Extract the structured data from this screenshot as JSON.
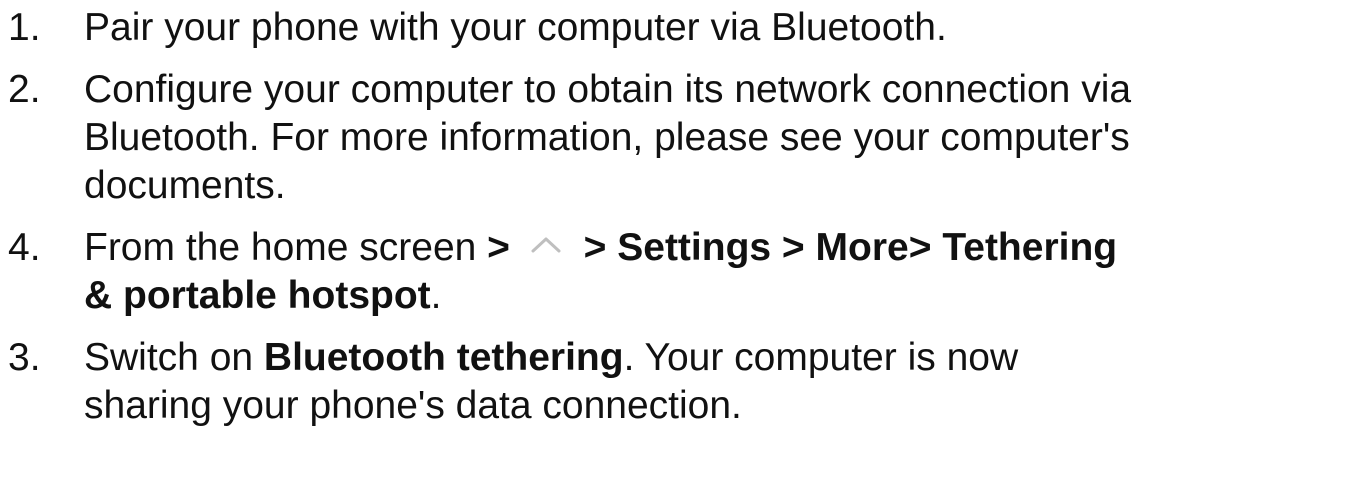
{
  "steps": [
    {
      "number": "1.",
      "text": "Pair your phone with your computer via Bluetooth."
    },
    {
      "number": "2.",
      "line1": "Configure your computer to obtain its network connection via",
      "line2": "Bluetooth. For more information, please see your computer's",
      "line3": "documents."
    },
    {
      "number": "4.",
      "prefix": "From the home screen",
      "sep1": " >",
      "icon": "chevron-up-icon",
      "path": " > Settings > More> Tethering",
      "path2": "& portable hotspot",
      "suffix": "."
    },
    {
      "number": "3.",
      "prefix": "Switch on ",
      "bold": "Bluetooth tethering",
      "rest": ". Your computer is now",
      "line2": "sharing your phone's data connection."
    }
  ]
}
